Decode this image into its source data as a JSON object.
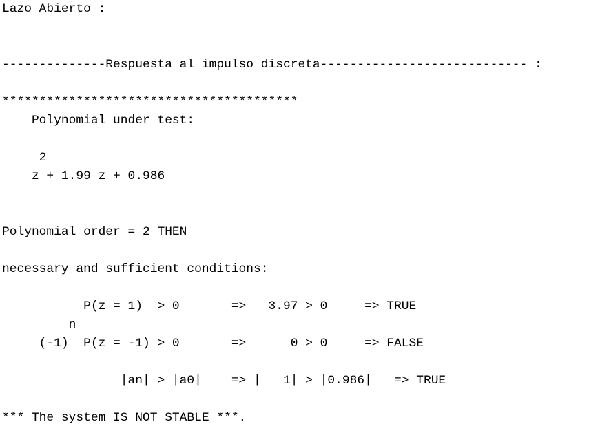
{
  "console": {
    "lines": [
      "Lazo Abierto :",
      "",
      "",
      "--------------Respuesta al impulso discreta---------------------------- :",
      "",
      "****************************************",
      "    Polynomial under test:",
      "",
      "     2",
      "    z + 1.99 z + 0.986",
      "",
      "",
      "Polynomial order = 2 THEN",
      "",
      "necessary and sufficient conditions:",
      "",
      "           P(z = 1)  > 0       =>   3.97 > 0     => TRUE",
      "         n",
      "     (-1)  P(z = -1) > 0       =>      0 > 0     => FALSE",
      "",
      "                |an| > |a0|    => |   1| > |0.986|   => TRUE",
      "",
      "*** The system IS NOT STABLE ***."
    ]
  }
}
